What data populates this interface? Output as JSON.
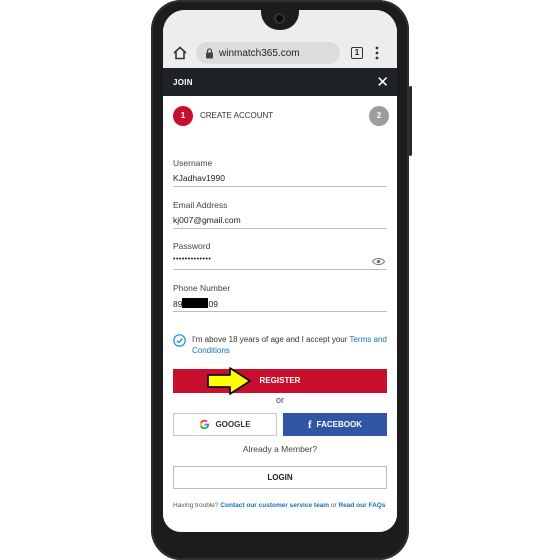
{
  "browser": {
    "url": "winmatch365.com",
    "tab_count": "1"
  },
  "header": {
    "title": "JOIN"
  },
  "steps": {
    "step1_number": "1",
    "step1_label": "CREATE ACCOUNT",
    "step2_number": "2"
  },
  "form": {
    "username_label": "Username",
    "username_value": "KJadhav1990",
    "email_label": "Email Address",
    "email_value": "kj007@gmail.com",
    "password_label": "Password",
    "password_value": "•••••••••••••",
    "phone_label": "Phone Number",
    "phone_prefix": "89",
    "phone_suffix": "09"
  },
  "consent": {
    "text": "I'm above 18 years of age and I accept your ",
    "link": "Terms and Conditions"
  },
  "buttons": {
    "register": "REGISTER",
    "or": "or",
    "google": "GOOGLE",
    "facebook": "FACEBOOK",
    "already_member": "Already a Member?",
    "login": "LOGIN"
  },
  "footer": {
    "prefix": "Having trouble? ",
    "contact_link": "Contact our customer service team",
    "middle": " or ",
    "faq_link": "Read our FAQs"
  },
  "colors": {
    "brand_red": "#c8102e",
    "facebook_blue": "#2f55a4",
    "header_dark": "#1f2328",
    "link_blue": "#1a6fb5",
    "annotation_arrow": "#ffff00"
  },
  "icons": [
    "home-icon",
    "lock-icon",
    "tab-switcher-icon",
    "kebab-menu-icon",
    "close-icon",
    "eye-icon",
    "checkmark-icon",
    "google-icon",
    "facebook-icon",
    "arrow-annotation"
  ]
}
